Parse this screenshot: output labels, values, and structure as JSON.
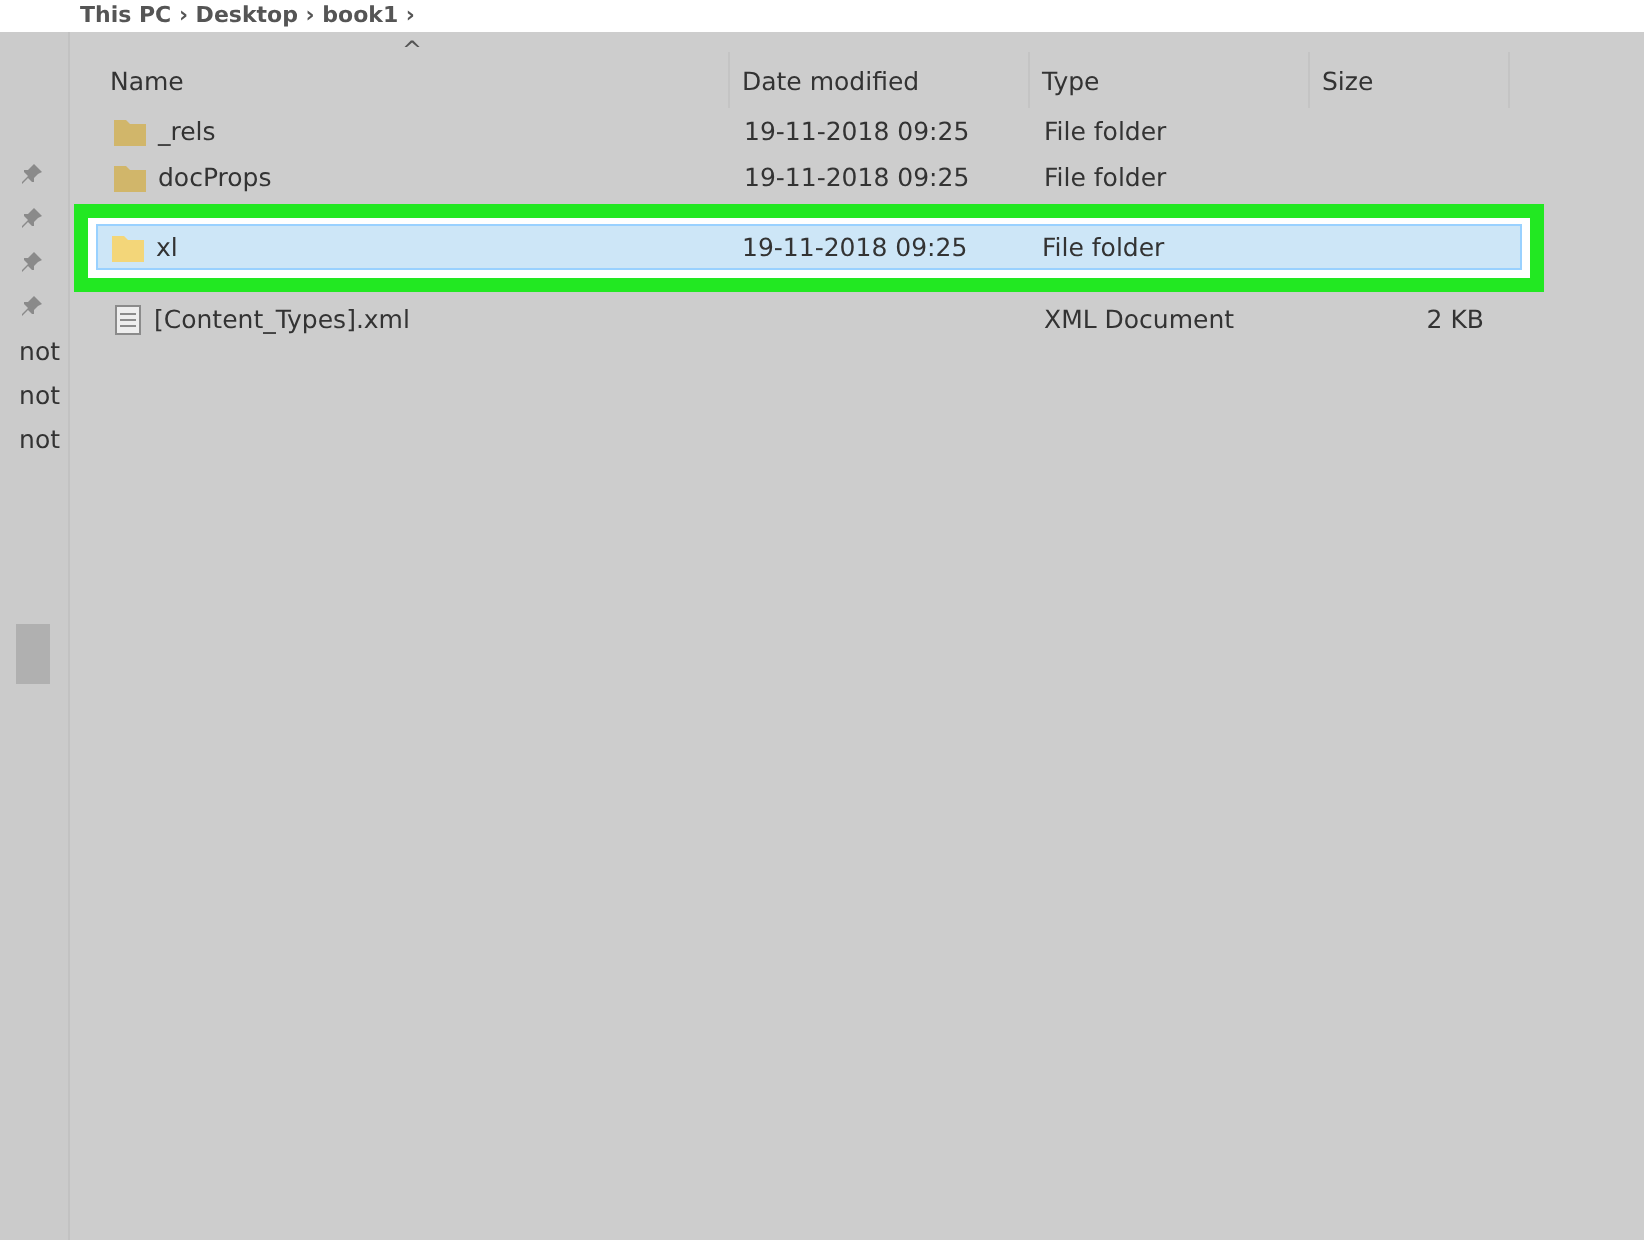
{
  "breadcrumb": "This PC › Desktop › book1 ›",
  "quick_access": [
    {
      "kind": "pin"
    },
    {
      "kind": "pin"
    },
    {
      "kind": "pin"
    },
    {
      "kind": "pin"
    },
    {
      "kind": "text",
      "label": "not"
    },
    {
      "kind": "text",
      "label": "not"
    },
    {
      "kind": "text",
      "label": "not"
    }
  ],
  "table": {
    "sort_indicator": "^",
    "columns": [
      "Name",
      "Date modified",
      "Type",
      "Size"
    ],
    "rows": [
      {
        "kind": "folder",
        "name": "_rels",
        "date": "19-11-2018 09:25",
        "type": "File folder",
        "size": "",
        "selected": false
      },
      {
        "kind": "folder",
        "name": "docProps",
        "date": "19-11-2018 09:25",
        "type": "File folder",
        "size": "",
        "selected": false
      },
      {
        "kind": "folder",
        "name": "xl",
        "date": "19-11-2018 09:25",
        "type": "File folder",
        "size": "",
        "selected": true
      },
      {
        "kind": "file",
        "name": "[Content_Types].xml",
        "date": "",
        "type": "XML Document",
        "size": "2 KB",
        "selected": false
      }
    ]
  }
}
